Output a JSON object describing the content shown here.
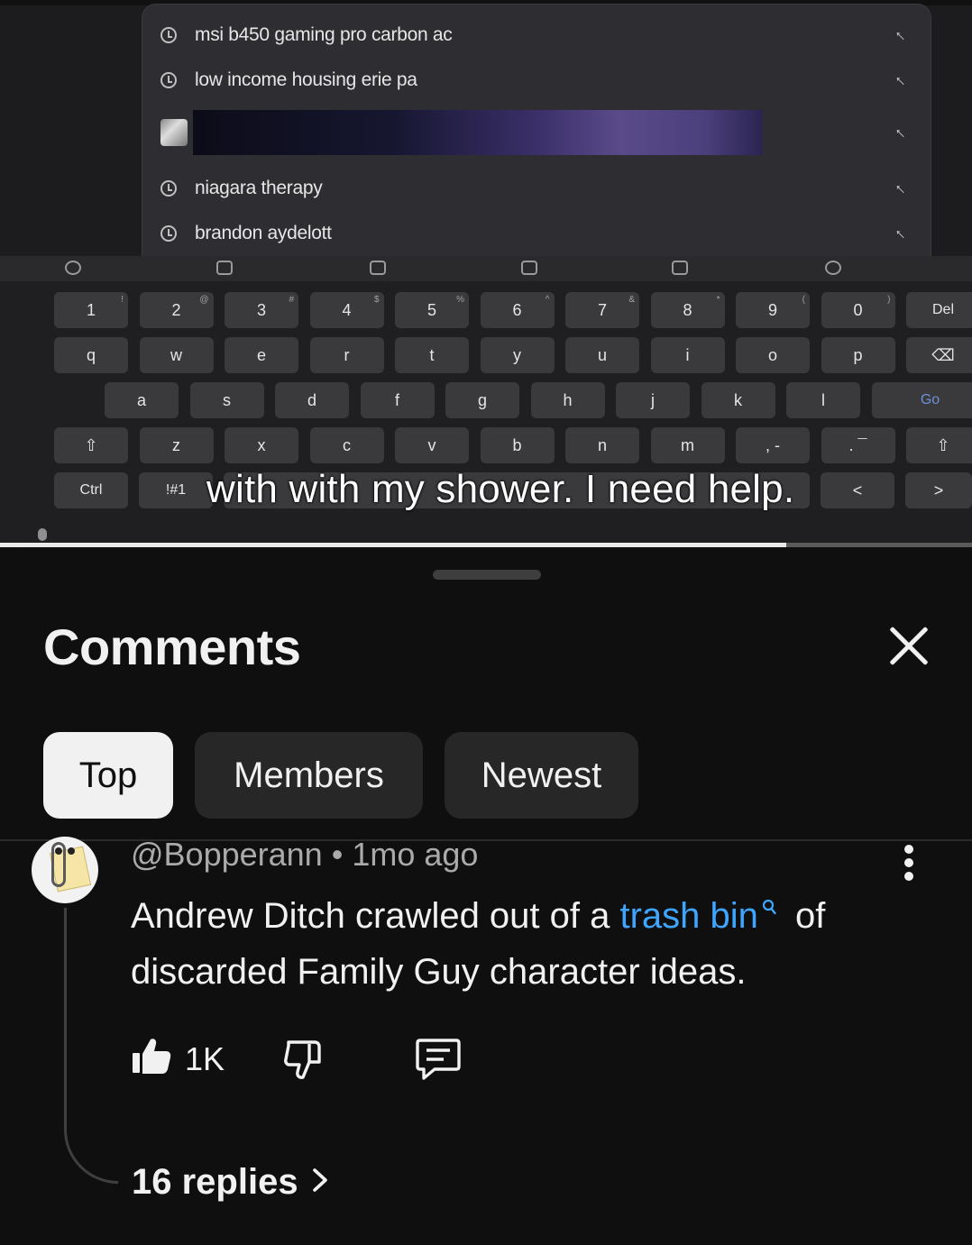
{
  "video": {
    "search_suggestions": [
      "msi b450 gaming pro carbon ac",
      "low income housing erie pa",
      "",
      "niagara therapy",
      "brandon aydelott"
    ],
    "keyboard": {
      "row1": [
        {
          "k": "1",
          "s": "!"
        },
        {
          "k": "2",
          "s": "@"
        },
        {
          "k": "3",
          "s": "#"
        },
        {
          "k": "4",
          "s": "$"
        },
        {
          "k": "5",
          "s": "%"
        },
        {
          "k": "6",
          "s": "^"
        },
        {
          "k": "7",
          "s": "&"
        },
        {
          "k": "8",
          "s": "*"
        },
        {
          "k": "9",
          "s": "("
        },
        {
          "k": "0",
          "s": ")"
        },
        {
          "k": "Del",
          "s": ""
        }
      ],
      "row2": [
        "q",
        "w",
        "e",
        "r",
        "t",
        "y",
        "u",
        "i",
        "o",
        "p",
        "⌫"
      ],
      "row3": [
        "a",
        "s",
        "d",
        "f",
        "g",
        "h",
        "j",
        "k",
        "l",
        "Go"
      ],
      "row4": [
        "⇧",
        "z",
        "x",
        "c",
        "v",
        "b",
        "n",
        "m",
        ", -",
        ". ¯",
        "⇧"
      ],
      "row5": [
        "Ctrl",
        "!#1",
        "<",
        ">"
      ]
    },
    "caption": "with with my shower. I need help.",
    "progress_fraction": 0.809
  },
  "comments": {
    "title": "Comments",
    "tabs": [
      "Top",
      "Members",
      "Newest"
    ],
    "active_tab": "Top",
    "comment": {
      "author": "@Bopperann",
      "separator": "•",
      "time": "1mo ago",
      "text_before": "Andrew Ditch crawled out of a ",
      "link_text": "trash bin",
      "text_after": " of discarded Family Guy character ideas.",
      "like_count": "1K",
      "replies": "16 replies"
    }
  },
  "colors": {
    "background": "#0f0f0f",
    "chip": "#272727",
    "chip_active": "#f1f1f1",
    "link": "#3ea6ff",
    "secondary_text": "#aaaaaa"
  }
}
